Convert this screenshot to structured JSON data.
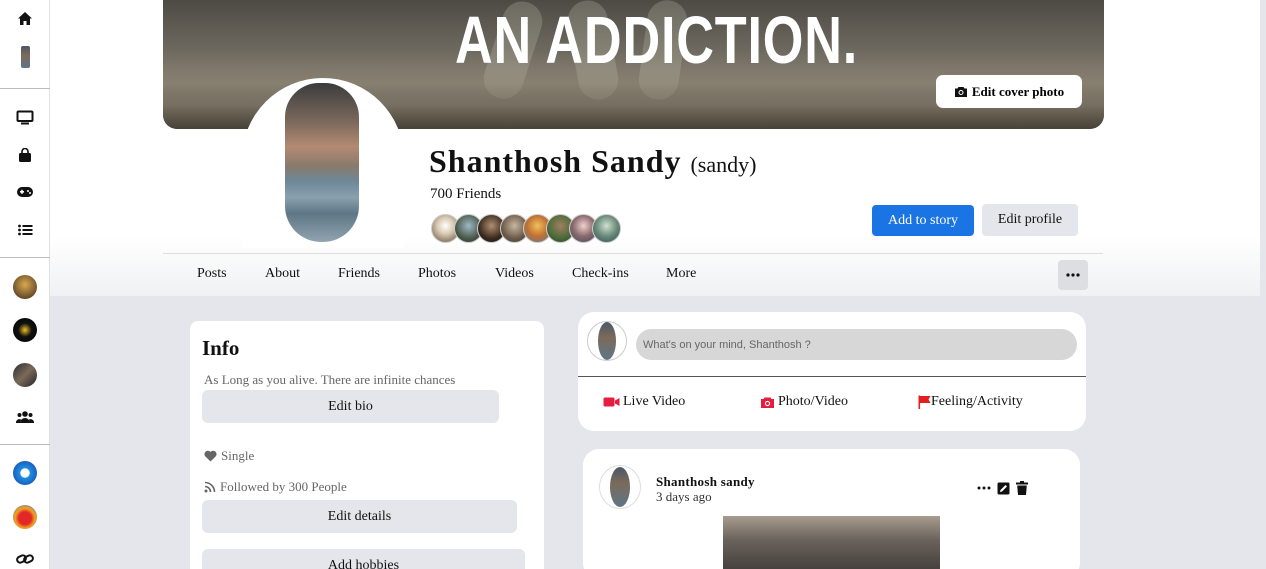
{
  "sidebar": {
    "icons": [
      "home-icon",
      "profile-avatar",
      "watch-icon",
      "marketplace-icon",
      "gaming-icon",
      "list-icon",
      "shortcut-1-avatar",
      "shortcut-2-avatar",
      "shortcut-3-avatar",
      "groups-icon",
      "shortcut-4-avatar",
      "shortcut-5-avatar",
      "link-icon"
    ]
  },
  "cover": {
    "text": "AN ADDICTION.",
    "edit_label": "Edit cover photo"
  },
  "profile": {
    "name": "Shanthosh Sandy",
    "nickname": "(sandy)",
    "friends_count": "700 Friends",
    "add_story_label": "Add to story",
    "edit_profile_label": "Edit profile"
  },
  "tabs": [
    "Posts",
    "About",
    "Friends",
    "Photos",
    "Videos",
    "Check-ins",
    "More"
  ],
  "info": {
    "title": "Info",
    "bio": "As Long as you alive. There are infinite chances",
    "edit_bio_label": "Edit bio",
    "relationship": "Single",
    "followed_by": "Followed by 300 People",
    "edit_details_label": "Edit details",
    "add_hobbies_label": "Add hobbies"
  },
  "composer": {
    "placeholder": "What's on your mind, Shanthosh ?",
    "live_video": "Live Video",
    "photo_video": "Photo/Video",
    "feeling": "Feeling/Activity"
  },
  "post": {
    "author": "Shanthosh sandy",
    "time": "3 days ago"
  },
  "colors": {
    "primary": "#1b74e4",
    "live_red": "#e41e3f",
    "flag_red": "#e41e1e"
  }
}
